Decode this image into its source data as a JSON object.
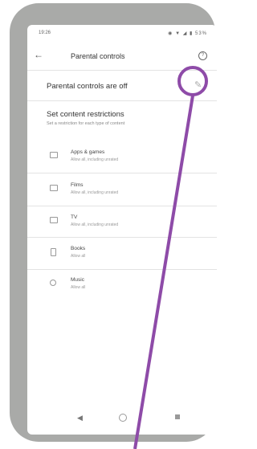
{
  "status_bar": {
    "time": "19:26",
    "icons": [
      "sim-icon",
      "location-icon",
      "wifi-icon",
      "signal-icon",
      "battery-icon"
    ],
    "battery": "53%"
  },
  "app_bar": {
    "title": "Parental controls",
    "back_icon": "arrow-left-icon",
    "help_icon": "help-icon"
  },
  "parental_controls": {
    "label": "Parental controls are off",
    "toggle_icon": "pencil-icon"
  },
  "restrictions": {
    "title": "Set content restrictions",
    "subtitle": "Set a restriction for each type of content",
    "items": [
      {
        "title": "Apps & games",
        "subtitle": "Allow all, including unrated",
        "icon": "apps-icon"
      },
      {
        "title": "Films",
        "subtitle": "Allow all, including unrated",
        "icon": "film-icon"
      },
      {
        "title": "TV",
        "subtitle": "Allow all, including unrated",
        "icon": "tv-icon"
      },
      {
        "title": "Books",
        "subtitle": "Allow all",
        "icon": "book-icon"
      },
      {
        "title": "Music",
        "subtitle": "Allow all",
        "icon": "music-icon"
      }
    ]
  },
  "nav_bar": {
    "icons": [
      "back-triangle-icon",
      "home-circle-icon",
      "recents-square-icon"
    ]
  },
  "colors": {
    "phone_frame": "#a9aaa8",
    "annotation": "#8e4ba8"
  }
}
